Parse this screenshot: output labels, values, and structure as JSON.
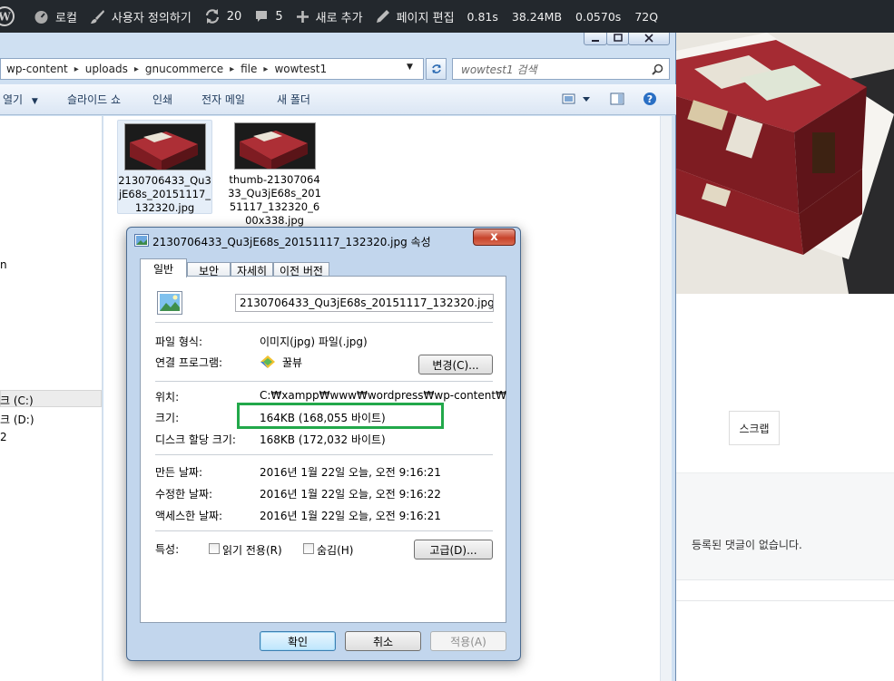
{
  "admin_bar": {
    "login": "로컬",
    "customize": "사용자 정의하기",
    "updates": "20",
    "comments": "5",
    "add_new": "새로 추가",
    "edit_page": "페이지 편집",
    "stats": [
      "0.81s",
      "38.24MB",
      "0.0570s",
      "72Q"
    ]
  },
  "explorer": {
    "breadcrumbs": [
      "wp-content",
      "uploads",
      "gnucommerce",
      "file",
      "wowtest1"
    ],
    "search_placeholder": "wowtest1 검색",
    "toolbar": {
      "open": "열기",
      "slideshow": "슬라이드 쇼",
      "print": "인쇄",
      "email": "전자 메일",
      "new_folder": "새 폴더"
    },
    "nav": [
      {
        "label": "n"
      },
      {
        "label": "크 (C:)"
      },
      {
        "label": "크 (D:)"
      },
      {
        "label": "2"
      }
    ],
    "files": [
      {
        "name": "2130706433_Qu3jE68s_20151117_132320.jpg"
      },
      {
        "name": "thumb-2130706433_Qu3jE68s_20151117_132320_600x338.jpg"
      }
    ]
  },
  "dialog": {
    "title": "2130706433_Qu3jE68s_20151117_132320.jpg 속성",
    "tabs": [
      "일반",
      "보안",
      "자세히",
      "이전 버전"
    ],
    "filename": "2130706433_Qu3jE68s_20151117_132320.jpg",
    "file_type_label": "파일 형식:",
    "file_type": "이미지(jpg) 파일(.jpg)",
    "open_with_label": "연결 프로그램:",
    "open_with": "꿀뷰",
    "change_button": "변경(C)...",
    "location_label": "위치:",
    "location": "C:₩xampp₩www₩wordpress₩wp-content₩",
    "size_label": "크기:",
    "size": "164KB (168,055 바이트)",
    "size_on_disk_label": "디스크 할당 크기:",
    "size_on_disk": "168KB (172,032 바이트)",
    "created_label": "만든 날짜:",
    "created": "2016년 1월 22일 오늘, 오전 9:16:21",
    "modified_label": "수정한 날짜:",
    "modified": "2016년 1월 22일 오늘, 오전 9:16:22",
    "accessed_label": "액세스한 날짜:",
    "accessed": "2016년 1월 22일 오늘, 오전 9:16:21",
    "attributes_label": "특성:",
    "readonly_label": "읽기 전용(R)",
    "hidden_label": "숨김(H)",
    "advanced_button": "고급(D)...",
    "ok_button": "확인",
    "cancel_button": "취소",
    "apply_button": "적용(A)",
    "close_glyph": "x"
  },
  "page": {
    "scrap_button": "스크랩",
    "no_comments": "등록된 댓글이 없습니다."
  },
  "colors": {
    "admin_bar_bg": "#23282d",
    "highlight_border": "#22a84a",
    "close_button": "#c7432b"
  }
}
